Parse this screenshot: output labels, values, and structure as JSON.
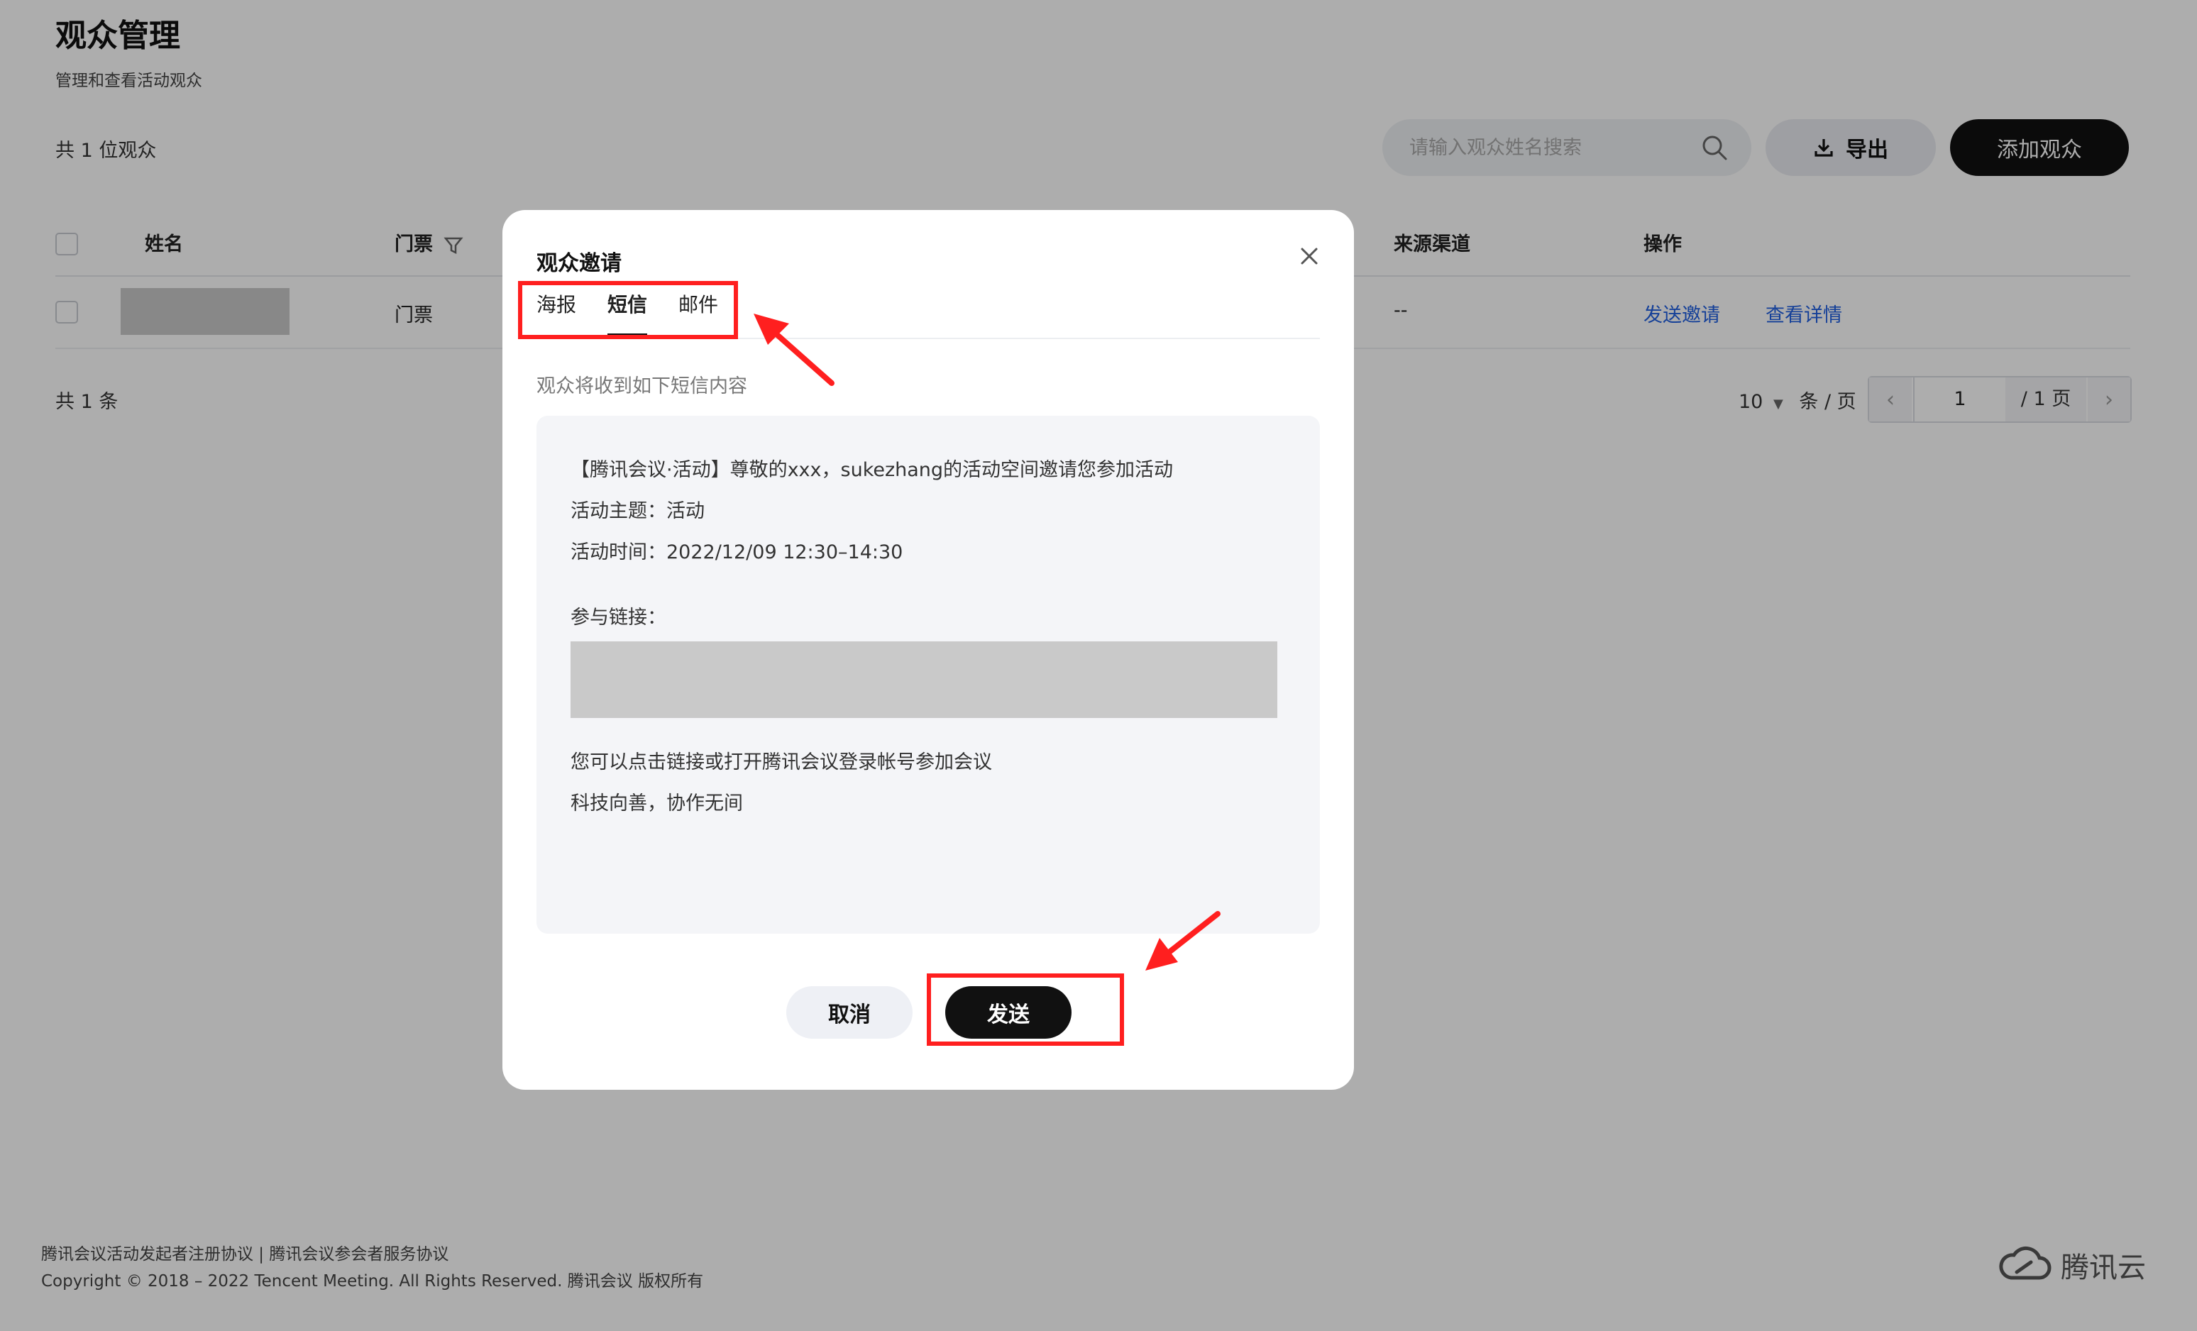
{
  "page": {
    "title": "观众管理",
    "subtitle": "管理和查看活动观众",
    "total_label": "共 1 位观众"
  },
  "toolbar": {
    "search_placeholder": "请输入观众姓名搜索",
    "export_label": "导出",
    "add_label": "添加观众"
  },
  "table": {
    "columns": [
      "姓名",
      "门票",
      "来源渠道",
      "操作"
    ],
    "rows": [
      {
        "ticket": "门票",
        "source": "--",
        "action_invite": "发送邀请",
        "action_details": "查看详情"
      }
    ]
  },
  "pagination": {
    "total": "共 1 条",
    "page_size": "10",
    "per_page_label": "条 / 页",
    "current_page": "1",
    "total_pages": "/ 1 页"
  },
  "footer": {
    "legal": "腾讯会议活动发起者注册协议 | 腾讯会议参会者服务协议",
    "copyright": "Copyright © 2018 – 2022 Tencent Meeting. All Rights Reserved. 腾讯会议 版权所有",
    "brand": "腾讯云"
  },
  "modal": {
    "title": "观众邀请",
    "tabs": [
      "海报",
      "短信",
      "邮件"
    ],
    "active_tab": "短信",
    "hint": "观众将收到如下短信内容",
    "sms": {
      "line1": "【腾讯会议·活动】尊敬的xxx，sukezhang的活动空间邀请您参加活动",
      "line2": "活动主题：活动",
      "line3": "活动时间：2022/12/09 12:30–14:30",
      "link_label": "参与链接：",
      "line4": "您可以点击链接或打开腾讯会议登录帐号参加会议",
      "line5": "科技向善，协作无间"
    },
    "cancel_label": "取消",
    "send_label": "发送"
  },
  "colors": {
    "highlight": "#ff1f1f",
    "link": "#1f5fe0",
    "primary_button": "#111111"
  }
}
